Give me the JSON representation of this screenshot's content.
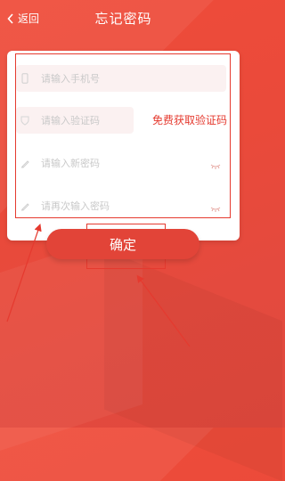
{
  "header": {
    "back_label": "返回",
    "title": "忘记密码"
  },
  "form": {
    "phone_placeholder": "请输入手机号",
    "code_placeholder": "请输入验证码",
    "get_code_label": "免费获取验证码",
    "new_password_placeholder": "请输入新密码",
    "confirm_password_placeholder": "请再次输入密码"
  },
  "actions": {
    "confirm_label": "确定"
  },
  "colors": {
    "accent": "#e53a2f",
    "background": "#ea4a3a",
    "placeholder": "#c9c9c9"
  },
  "icons": [
    "back-chevron-icon",
    "phone-icon",
    "shield-icon",
    "pencil-icon",
    "eye-closed-icon"
  ]
}
